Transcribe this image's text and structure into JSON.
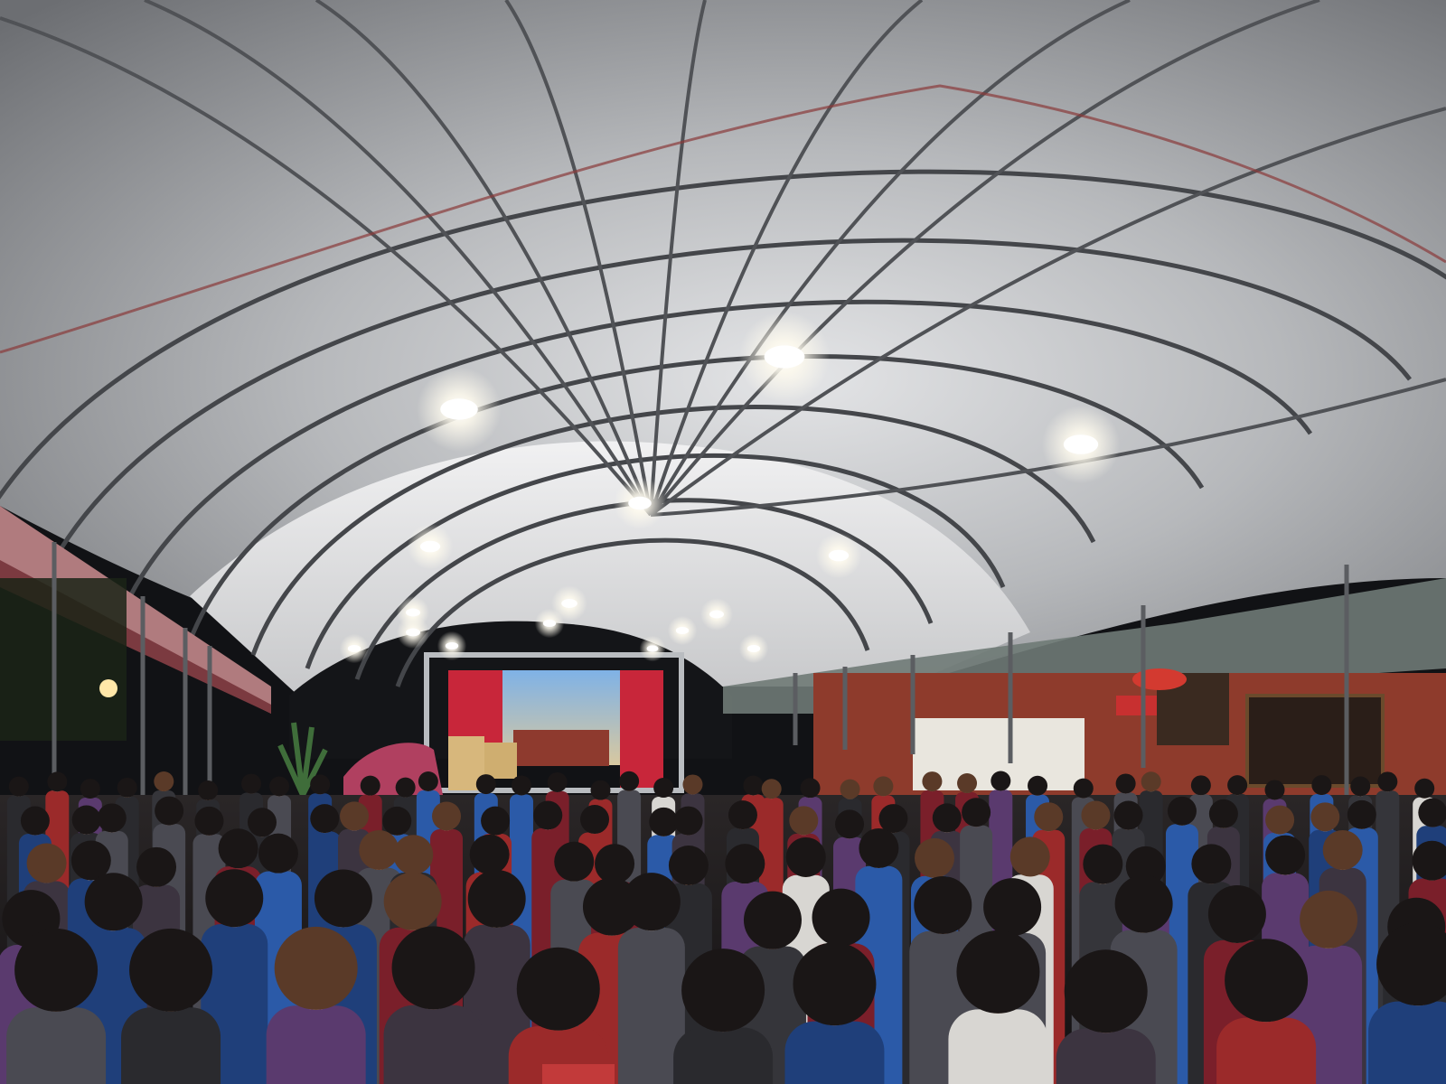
{
  "scene": {
    "kind": "photograph",
    "subject": "crowd-under-arched-tent-at-night",
    "palette": {
      "canopy_light": "#d9dadc",
      "canopy_mid": "#9a9c9f",
      "canopy_dark": "#55575b",
      "frame_steel": "#4a4c50",
      "night_sky": "#101114",
      "stage_red": "#c8263a",
      "stage_blue": "#5f8fc9",
      "brick_wall": "#8e3b2c",
      "lamp_glow": "#fffbee",
      "crowd_dark": "#1d1b1c",
      "hedge_green": "#2f5a2a"
    }
  },
  "lamps": {
    "count": 16
  },
  "signage": {
    "stage_banner_text": "",
    "wall_sign_text": ""
  }
}
